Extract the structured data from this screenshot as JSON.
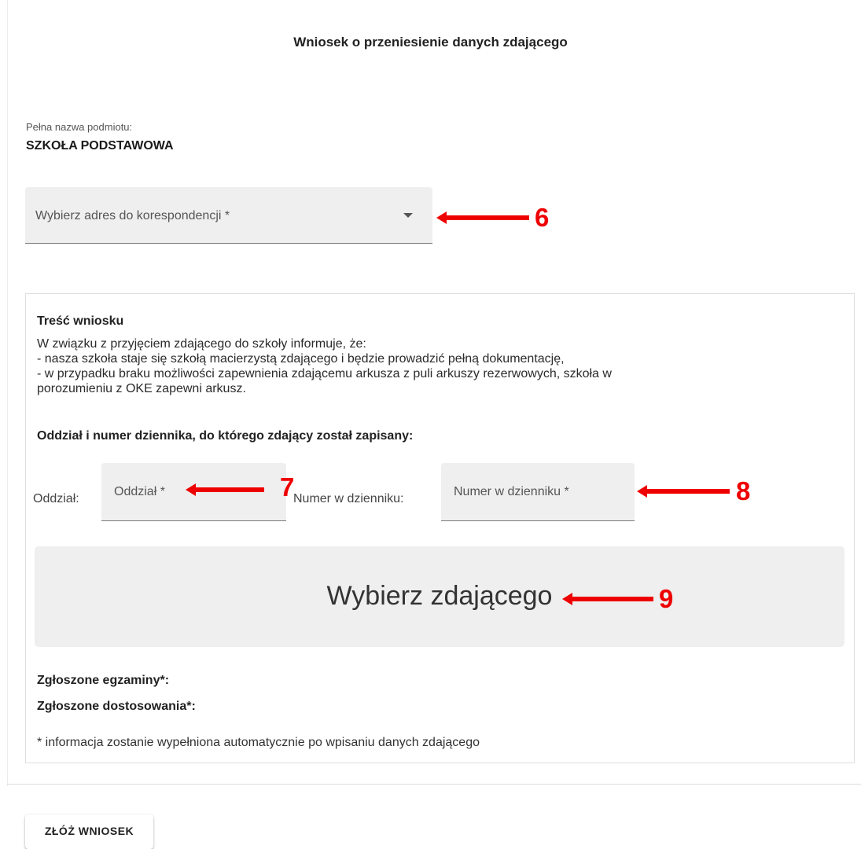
{
  "page": {
    "title": "Wniosek o przeniesienie danych zdającego"
  },
  "entity": {
    "label": "Pełna nazwa podmiotu:",
    "value": "SZKOŁA PODSTAWOWA"
  },
  "address_select": {
    "placeholder": "Wybierz adres do korespondencji *"
  },
  "request": {
    "title": "Treść wniosku",
    "lines": [
      "W związku z przyjęciem zdającego do szkoły informuje, że:",
      "- nasza szkoła staje się szkołą macierzystą zdającego i będzie prowadzić pełną dokumentację,",
      "- w przypadku braku możliwości zapewnienia zdającemu arkusza z puli arkuszy rezerwowych, szkoła w",
      "porozumieniu z OKE zapewni arkusz."
    ],
    "section_title": "Oddział i numer dziennika, do którego zdający został zapisany:",
    "class_label": "Oddział:",
    "class_placeholder": "Oddział *",
    "number_label": "Numer w dzienniku:",
    "number_placeholder": "Numer w dzienniku *",
    "pick_button": "Wybierz zdającego",
    "exams_label": "Zgłoszone egzaminy*:",
    "accommodations_label": "Zgłoszone dostosowania*:",
    "auto_note": "* informacja zostanie wypełniona automatycznie po wpisaniu danych zdającego"
  },
  "submit": {
    "label": "ZŁÓŻ WNIOSEK"
  },
  "annotations": [
    {
      "number": "6"
    },
    {
      "number": "7"
    },
    {
      "number": "8"
    },
    {
      "number": "9"
    }
  ],
  "colors": {
    "annotation": "#ee0000",
    "field_background": "#efefef"
  },
  "icons": {
    "dropdown": "caret-down-icon",
    "annotation_arrow": "left-arrow-icon"
  }
}
